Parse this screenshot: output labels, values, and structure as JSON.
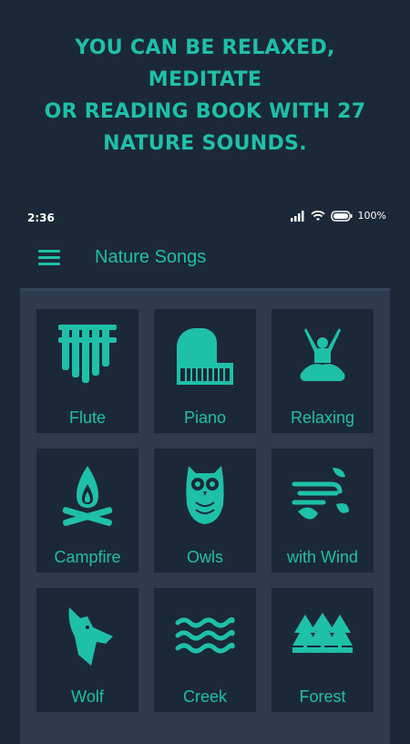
{
  "promo": {
    "line1": "You can be relaxed, meditate",
    "line2": "or reading book with 27",
    "line3": "nature sounds."
  },
  "status": {
    "time": "2:36",
    "battery": "100%"
  },
  "appbar": {
    "title": "Nature Songs",
    "menu_icon": "hamburger-menu-icon"
  },
  "colors": {
    "accent": "#1fc0a8",
    "background": "#1b2838",
    "panel": "#2e3b4e"
  },
  "tiles": [
    {
      "label": "Flute",
      "icon": "pan-flute-icon"
    },
    {
      "label": "Piano",
      "icon": "piano-icon"
    },
    {
      "label": "Relaxing",
      "icon": "meditation-icon"
    },
    {
      "label": "Campfire",
      "icon": "campfire-icon"
    },
    {
      "label": "Owls",
      "icon": "owl-icon"
    },
    {
      "label": "with Wind",
      "icon": "wind-leaves-icon"
    },
    {
      "label": "Wolf",
      "icon": "wolf-icon"
    },
    {
      "label": "Creek",
      "icon": "water-waves-icon"
    },
    {
      "label": "Forest",
      "icon": "forest-icon"
    }
  ]
}
